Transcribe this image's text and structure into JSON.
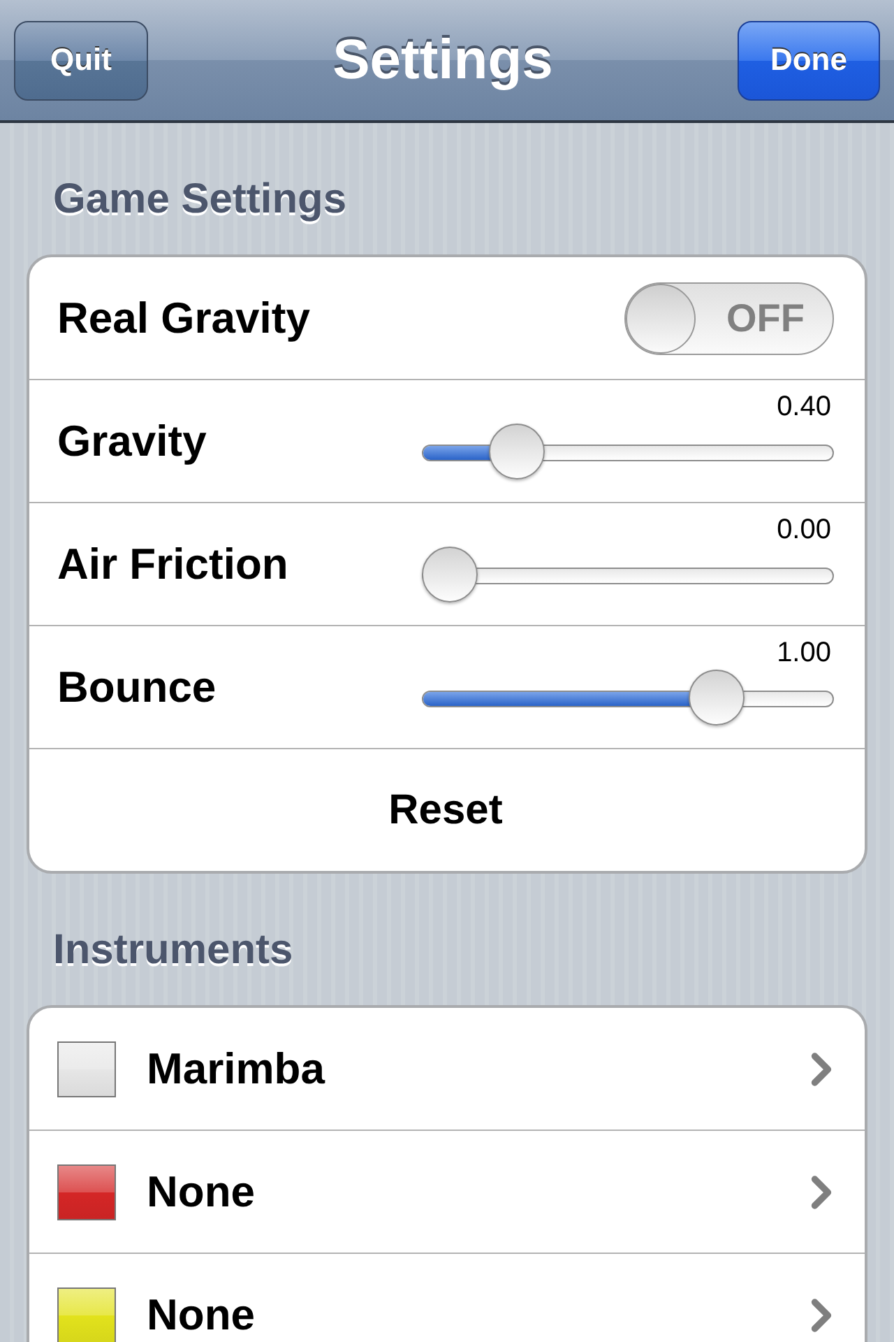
{
  "nav_bar": {
    "left_button": "Quit",
    "title": "Settings",
    "right_button": "Done"
  },
  "sections": [
    {
      "header": "Game Settings",
      "rows": [
        {
          "kind": "toggle",
          "label": "Real Gravity",
          "on": false,
          "state_text": "OFF"
        },
        {
          "kind": "slider",
          "label": "Gravity",
          "reading": "0.40",
          "level": 0.19
        },
        {
          "kind": "slider",
          "label": "Air Friction",
          "reading": "0.00",
          "level": 0
        },
        {
          "kind": "slider",
          "label": "Bounce",
          "reading": "1.00",
          "level": 0.75
        },
        {
          "kind": "button",
          "label": "Reset"
        }
      ]
    },
    {
      "header": "Instruments",
      "rows": [
        {
          "kind": "instrument",
          "label": "Marimba",
          "color": "#e6e6e6"
        },
        {
          "kind": "instrument",
          "label": "None",
          "color": "#d42626"
        },
        {
          "kind": "instrument",
          "label": "None",
          "color": "#e2e21c"
        }
      ]
    }
  ]
}
